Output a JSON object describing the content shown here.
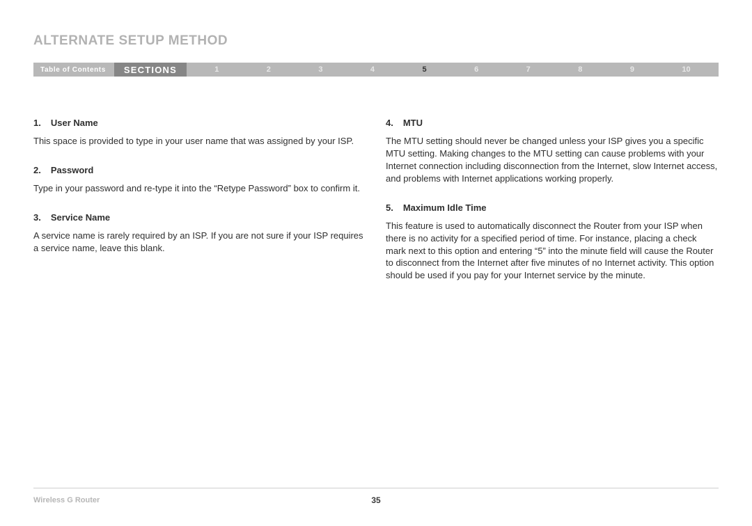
{
  "title": "ALTERNATE SETUP METHOD",
  "nav": {
    "toc": "Table of Contents",
    "label": "SECTIONS",
    "items": [
      {
        "n": "1",
        "current": false
      },
      {
        "n": "2",
        "current": false
      },
      {
        "n": "3",
        "current": false
      },
      {
        "n": "4",
        "current": false
      },
      {
        "n": "5",
        "current": true
      },
      {
        "n": "6",
        "current": false
      },
      {
        "n": "7",
        "current": false
      },
      {
        "n": "8",
        "current": false
      },
      {
        "n": "9",
        "current": false
      },
      {
        "n": "10",
        "current": false
      }
    ]
  },
  "left": [
    {
      "num": "1.",
      "title": "User Name",
      "body": "This space is provided to type in your user name that was assigned by your ISP."
    },
    {
      "num": "2.",
      "title": "Password",
      "body": "Type in your password and re-type it into the “Retype Password” box to confirm it."
    },
    {
      "num": "3.",
      "title": "Service Name",
      "body": "A service name is rarely required by an ISP. If you are not sure if your ISP requires a service name, leave this blank."
    }
  ],
  "right": [
    {
      "num": "4.",
      "title": "MTU",
      "body": "The MTU setting should never be changed unless your ISP gives you a specific MTU setting. Making changes to the MTU setting can cause problems with your Internet connection including disconnection from the Internet, slow Internet access, and problems with Internet applications working properly."
    },
    {
      "num": "5.",
      "title": "Maximum Idle Time",
      "body": "This feature is used to automatically disconnect the Router from your ISP when there is no activity for a specified period of time. For instance, placing a check mark next to this option and entering “5” into the minute field will cause the Router to disconnect from the Internet after five minutes of no Internet activity. This option should be used if you pay for your Internet service by the minute."
    }
  ],
  "footer": {
    "product": "Wireless G Router",
    "page": "35"
  }
}
